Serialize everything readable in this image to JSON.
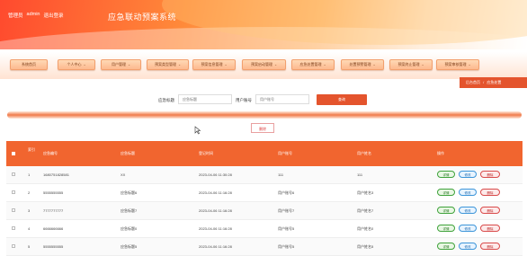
{
  "header": {
    "user_prefix": "管理员",
    "username": "admin",
    "logout_label": "退出登录",
    "system_title": "应急联动预案系统"
  },
  "nav": {
    "items": [
      {
        "label": "系统首页"
      },
      {
        "label": "个人中心"
      },
      {
        "label": "用户管理"
      },
      {
        "label": "预案类型管理"
      },
      {
        "label": "预案信息管理"
      },
      {
        "label": "预案启动管理"
      },
      {
        "label": "应急处置管理"
      },
      {
        "label": "处置预警管理"
      },
      {
        "label": "预案终止管理"
      },
      {
        "label": "预案审核管理"
      }
    ]
  },
  "breadcrumb": {
    "home": "后台首页",
    "separator": "/",
    "current": "应急处置"
  },
  "search": {
    "title_label": "应急标题",
    "title_placeholder": "应急标题",
    "account_label": "用户账号",
    "account_placeholder": "用户账号",
    "search_button": "查询"
  },
  "toolbar": {
    "delete_label": "删除"
  },
  "table": {
    "columns": [
      "索引",
      "应急编号",
      "应急标题",
      "登记时间",
      "用户账号",
      "用户姓名",
      "操作"
    ],
    "rows": [
      {
        "index": "1",
        "code": "1680751828581",
        "title": "XX",
        "time": "2023-04-06 11:30:28",
        "account": "111",
        "name": "111"
      },
      {
        "index": "2",
        "code": "5555555555",
        "title": "应急标题6",
        "time": "2023-04-06 11:16:28",
        "account": "用户账号6",
        "name": "用户姓名3"
      },
      {
        "index": "3",
        "code": "7777777777",
        "title": "应急标题7",
        "time": "2023-04-06 11:16:28",
        "account": "用户账号7",
        "name": "用户姓名7"
      },
      {
        "index": "4",
        "code": "6666666666",
        "title": "应急标题0",
        "time": "2023-04-06 11:16:28",
        "account": "用户账号5",
        "name": "用户姓名0"
      },
      {
        "index": "5",
        "code": "5555555555",
        "title": "应急标题5",
        "time": "2023-04-06 11:16:28",
        "account": "用户账号5",
        "name": "用户姓名5"
      }
    ],
    "actions": {
      "detail": "详情",
      "edit": "修改",
      "delete": "删除"
    }
  },
  "colors": {
    "accent": "#f1652f",
    "header_start": "#ff4a2e",
    "detail_border": "#3ea23a",
    "edit_border": "#3c95d9",
    "delete_border": "#d94a4a"
  }
}
